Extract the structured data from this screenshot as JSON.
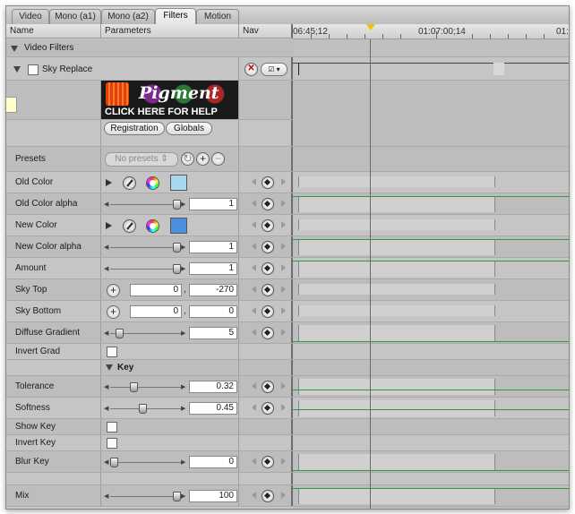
{
  "tabs": [
    {
      "label": "Video",
      "active": false
    },
    {
      "label": "Mono (a1)",
      "active": false
    },
    {
      "label": "Mono (a2)",
      "active": false
    },
    {
      "label": "Filters",
      "active": true
    },
    {
      "label": "Motion",
      "active": false
    }
  ],
  "columns": {
    "name": "Name",
    "parameters": "Parameters",
    "nav": "Nav"
  },
  "timeline": {
    "tc_start": "06:45;12",
    "tc_mid": "01:07:00;14",
    "tc_end": "01:"
  },
  "section": {
    "video_filters": "Video Filters"
  },
  "filter": {
    "name": "Sky Replace",
    "logo_title": "Pigment",
    "logo_help": "CLICK HERE FOR HELP"
  },
  "buttons": {
    "registration": "Registration",
    "globals": "Globals"
  },
  "presets": {
    "label": "Presets",
    "value": "No presets"
  },
  "colors": {
    "old_color": "#a8d8ee",
    "new_color": "#4a8fe0",
    "accent_green": "#2c9a3c"
  },
  "params": {
    "old_color": "Old Color",
    "old_color_alpha": {
      "label": "Old Color alpha",
      "value": "1",
      "level": 1.0
    },
    "new_color": "New Color",
    "new_color_alpha": {
      "label": "New Color alpha",
      "value": "1",
      "level": 1.0
    },
    "amount": {
      "label": "Amount",
      "value": "1",
      "level": 1.0
    },
    "sky_top": {
      "label": "Sky Top",
      "x": "0",
      "y": "-270"
    },
    "sky_bottom": {
      "label": "Sky Bottom",
      "x": "0",
      "y": "0"
    },
    "diffuse_gradient": {
      "label": "Diffuse Gradient",
      "value": "5",
      "level": 0.08
    },
    "invert_grad": "Invert Grad",
    "key_group": "Key",
    "tolerance": {
      "label": "Tolerance",
      "value": "0.32",
      "level": 0.32
    },
    "softness": {
      "label": "Softness",
      "value": "0.45",
      "level": 0.45
    },
    "show_key": "Show Key",
    "invert_key": "Invert Key",
    "blur_key": {
      "label": "Blur Key",
      "value": "0",
      "level": 0.0
    },
    "mix": {
      "label": "Mix",
      "value": "100",
      "level": 1.0
    }
  }
}
